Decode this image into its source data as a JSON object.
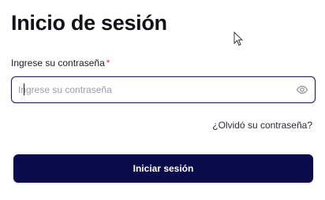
{
  "header": {
    "title": "Inicio de sesión"
  },
  "password_field": {
    "label": "Ingrese su contraseña",
    "required_marker": "*",
    "placeholder": "Ingrese su contraseña",
    "value": "",
    "toggle_icon": "eye-icon"
  },
  "links": {
    "forgot_password": "¿Olvidó su contraseña?"
  },
  "actions": {
    "login_label": "Iniciar sesión"
  },
  "colors": {
    "primary": "#0b0b4b",
    "input_border": "#1c1a5e",
    "required": "#d33a3a"
  }
}
